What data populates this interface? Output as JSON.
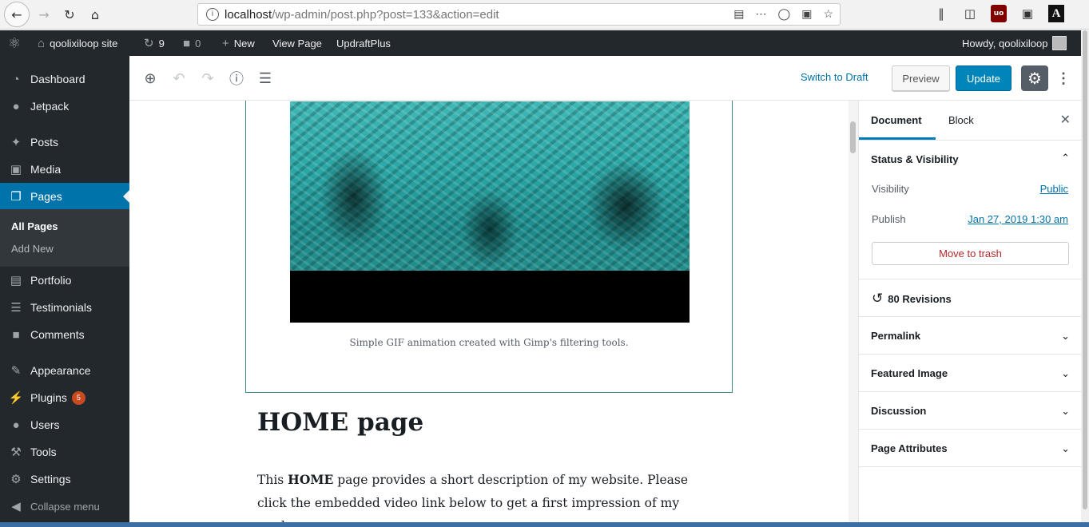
{
  "browser": {
    "url_host": "localhost",
    "url_path": "/wp-admin/post.php?post=133&action=edit"
  },
  "adminbar": {
    "site_name": "qoolixiloop site",
    "updates_count": "9",
    "comments_count": "0",
    "new_label": "New",
    "view_page_label": "View Page",
    "updraft_label": "UpdraftPlus",
    "howdy": "Howdy, qoolixiloop"
  },
  "sidebar": {
    "items": [
      {
        "label": "Dashboard",
        "icon": "dashboard-icon"
      },
      {
        "label": "Jetpack",
        "icon": "jetpack-icon"
      },
      {
        "label": "Posts",
        "icon": "pin-icon"
      },
      {
        "label": "Media",
        "icon": "media-icon"
      },
      {
        "label": "Pages",
        "icon": "pages-icon"
      },
      {
        "label": "Portfolio",
        "icon": "portfolio-icon"
      },
      {
        "label": "Testimonials",
        "icon": "testimonial-icon"
      },
      {
        "label": "Comments",
        "icon": "comment-icon"
      },
      {
        "label": "Appearance",
        "icon": "brush-icon"
      },
      {
        "label": "Plugins",
        "icon": "plugin-icon"
      },
      {
        "label": "Users",
        "icon": "user-icon"
      },
      {
        "label": "Tools",
        "icon": "wrench-icon"
      },
      {
        "label": "Settings",
        "icon": "settings-icon"
      }
    ],
    "sub_all_pages": "All Pages",
    "sub_add_new": "Add New",
    "plugins_badge": "5",
    "collapse": "Collapse menu",
    "active_color": "#0073aa"
  },
  "toolbar": {
    "switch_draft": "Switch to Draft",
    "preview": "Preview",
    "update": "Update"
  },
  "content": {
    "caption": "Simple GIF animation created with Gimp's filtering tools.",
    "heading": "HOME page",
    "para_pre": "This ",
    "para_bold": "HOME",
    "para_post": " page provides a short description of my website. Please click the embedded video link below to get a first impression of my work."
  },
  "settings": {
    "tab_document": "Document",
    "tab_block": "Block",
    "status_title": "Status & Visibility",
    "visibility_label": "Visibility",
    "visibility_value": "Public",
    "publish_label": "Publish",
    "publish_value": "Jan 27, 2019 1:30 am",
    "trash": "Move to trash",
    "revisions": "80 Revisions",
    "panels": [
      "Permalink",
      "Featured Image",
      "Discussion",
      "Page Attributes"
    ]
  }
}
